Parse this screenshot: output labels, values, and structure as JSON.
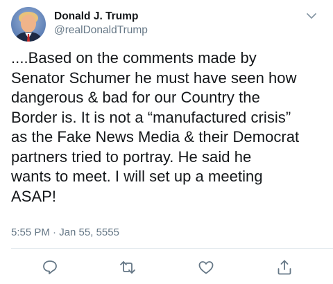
{
  "tweet": {
    "display_name": "Donald J. Trump",
    "handle": "@realDonaldTrump",
    "body": "....Based on the comments made by\nSenator Schumer he must have seen how\ndangerous & bad for our Country the\nBorder is. It is not a “manufactured crisis”\nas the Fake News Media & their Democrat\npartners tried to portray. He said he\nwants to meet. I will set up a meeting\nASAP!",
    "timestamp": "5:55 PM · Jan 55, 5555"
  },
  "icons": {
    "caret": "chevron-down-icon",
    "reply": "reply-icon",
    "retweet": "retweet-icon",
    "like": "heart-icon",
    "share": "share-icon"
  },
  "colors": {
    "text": "#14171a",
    "secondary": "#657786",
    "divider": "#e1e8ed"
  }
}
